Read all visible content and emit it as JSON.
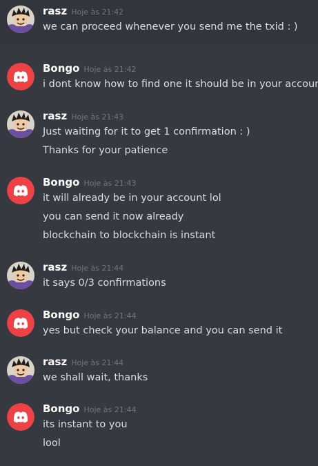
{
  "messages": [
    {
      "author": "rasz",
      "avatar": "anime-avatar",
      "time": "Hoje às 21:42",
      "lines": [
        "we can proceed whenever you send me the txid : )"
      ]
    },
    {
      "author": "Bongo",
      "avatar": "discord-logo",
      "time": "Hoje às 21:42",
      "lines": [
        "i dont know how to find one it should be in your account"
      ]
    },
    {
      "author": "rasz",
      "avatar": "anime-avatar",
      "time": "Hoje às 21:43",
      "lines": [
        "Just waiting for it to get 1 confirmation : )",
        "Thanks for your patience"
      ]
    },
    {
      "author": "Bongo",
      "avatar": "discord-logo",
      "time": "Hoje às 21:43",
      "lines": [
        "it will already be in your account lol",
        "you can send it now already",
        "blockchain to blockchain is instant"
      ]
    },
    {
      "author": "rasz",
      "avatar": "anime-avatar",
      "time": "Hoje às 21:44",
      "lines": [
        "it says 0/3 confirmations"
      ]
    },
    {
      "author": "Bongo",
      "avatar": "discord-logo",
      "time": "Hoje às 21:44",
      "lines": [
        "yes but check your balance and you can send it"
      ]
    },
    {
      "author": "rasz",
      "avatar": "anime-avatar",
      "time": "Hoje às 21:44",
      "lines": [
        "we shall wait, thanks"
      ]
    },
    {
      "author": "Bongo",
      "avatar": "discord-logo",
      "time": "Hoje às 21:44",
      "lines": [
        "its instant to you",
        "lool"
      ]
    }
  ],
  "colors": {
    "background": "#36393f",
    "discord_red": "#ed4245",
    "timestamp": "#72767d",
    "text": "#dcddde"
  }
}
